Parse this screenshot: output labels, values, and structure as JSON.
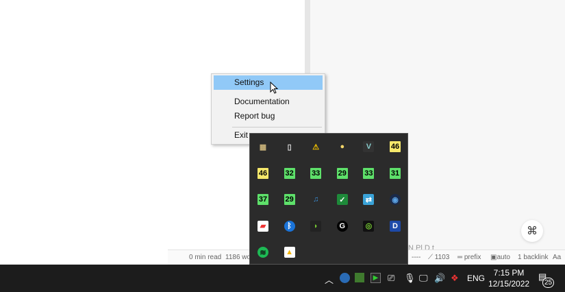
{
  "context_menu": {
    "items": [
      "Settings",
      "Documentation",
      "Report bug",
      "Exit"
    ],
    "highlighted": "Settings"
  },
  "statusbar": {
    "read_time": "0 min read",
    "words": "1186 wo",
    "dashes": "----",
    "count": "1103",
    "prefix": "prefix",
    "auto": "auto",
    "backlinks": "1 backlink",
    "font": "Aa"
  },
  "faint_text": "N  Pl     D  t",
  "command_button": "⌘",
  "tray_icons": [
    {
      "name": "app-icon",
      "label": ""
    },
    {
      "name": "document-icon",
      "label": ""
    },
    {
      "name": "warning-shield-icon",
      "label": ""
    },
    {
      "name": "bulb-icon",
      "label": ""
    },
    {
      "name": "vmware-warning-icon",
      "label": ""
    },
    {
      "name": "temp-icon",
      "label": "46",
      "color": "#f5e86b"
    },
    {
      "name": "temp-icon",
      "label": "46",
      "color": "#f5e86b"
    },
    {
      "name": "temp-icon",
      "label": "32",
      "color": "#5ee06a"
    },
    {
      "name": "temp-icon",
      "label": "33",
      "color": "#5ee06a"
    },
    {
      "name": "temp-icon",
      "label": "29",
      "color": "#5ee06a"
    },
    {
      "name": "temp-icon",
      "label": "33",
      "color": "#5ee06a"
    },
    {
      "name": "temp-icon",
      "label": "31",
      "color": "#5ee06a"
    },
    {
      "name": "temp-icon",
      "label": "37",
      "color": "#5ee06a"
    },
    {
      "name": "temp-icon",
      "label": "29",
      "color": "#5ee06a"
    },
    {
      "name": "music-icon",
      "label": ""
    },
    {
      "name": "checkbox-icon",
      "label": ""
    },
    {
      "name": "sync-icon",
      "label": ""
    },
    {
      "name": "circle-icon",
      "label": ""
    },
    {
      "name": "cards-icon",
      "label": ""
    },
    {
      "name": "bluetooth-icon",
      "label": ""
    },
    {
      "name": "headset-icon",
      "label": ""
    },
    {
      "name": "logitech-g-icon",
      "label": ""
    },
    {
      "name": "nvidia-icon",
      "label": ""
    },
    {
      "name": "d-icon",
      "label": ""
    },
    {
      "name": "spotify-icon",
      "label": ""
    },
    {
      "name": "google-drive-icon",
      "label": ""
    }
  ],
  "taskbar": {
    "language": "ENG",
    "time": "7:15 PM",
    "date": "12/15/2022",
    "notifications": "25"
  }
}
